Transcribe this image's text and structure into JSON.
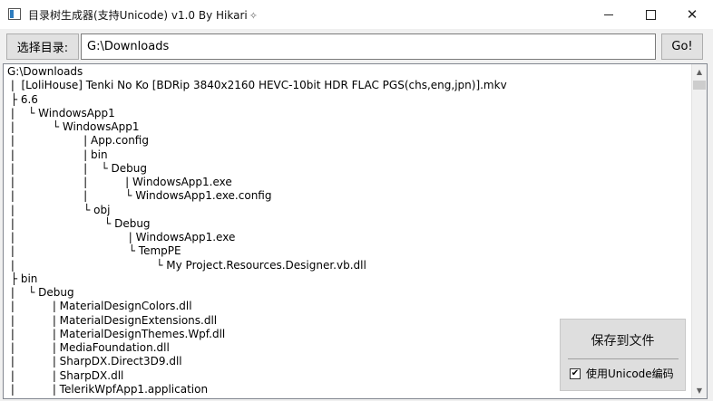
{
  "window": {
    "title": "目录树生成器(支持Unicode) v1.0 By Hikari",
    "controls": [
      "minimize",
      "maximize",
      "close"
    ]
  },
  "toolbar": {
    "select_dir_label": "选择目录:",
    "path_value": "G:\\Downloads",
    "go_label": "Go!"
  },
  "tree": {
    "lines": [
      "G:\\Downloads",
      " |  [LoliHouse] Tenki No Ko [BDRip 3840x2160 HEVC-10bit HDR FLAC PGS(chs,eng,jpn)].mkv",
      " ├ 6.6",
      " |    └ WindowsApp1",
      " |           └ WindowsApp1",
      " |                    | App.config",
      " |                    | bin",
      " |                    |    └ Debug",
      " |                    |           | WindowsApp1.exe",
      " |                    |           └ WindowsApp1.exe.config",
      " |                    └ obj",
      " |                          └ Debug",
      " |                                 | WindowsApp1.exe",
      " |                                 └ TempPE",
      " |                                         └ My Project.Resources.Designer.vb.dll",
      " ├ bin",
      " |    └ Debug",
      " |           | MaterialDesignColors.dll",
      " |           | MaterialDesignExtensions.dll",
      " |           | MaterialDesignThemes.Wpf.dll",
      " |           | MediaFoundation.dll",
      " |           | SharpDX.Direct3D9.dll",
      " |           | SharpDX.dll",
      " |           | TelerikWpfApp1.application"
    ]
  },
  "save_panel": {
    "save_label": "保存到文件",
    "unicode_label": "使用Unicode编码",
    "unicode_checked": true
  },
  "icons": {
    "app": "app-window-icon",
    "sparkle": "sparkle-icon",
    "check": "check-icon"
  }
}
